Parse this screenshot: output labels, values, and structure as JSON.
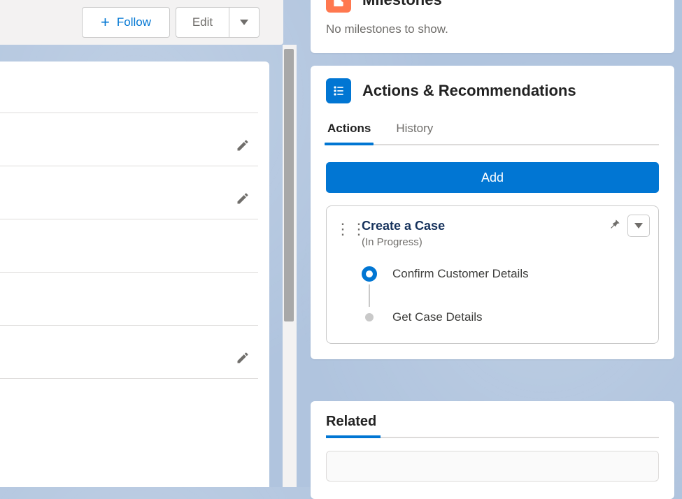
{
  "leftHeader": {
    "followLabel": "Follow",
    "editLabel": "Edit"
  },
  "milestones": {
    "title": "Milestones",
    "emptyText": "No milestones to show."
  },
  "actionsRec": {
    "title": "Actions & Recommendations",
    "tabs": {
      "actions": "Actions",
      "history": "History"
    },
    "addLabel": "Add",
    "flow": {
      "title": "Create a Case",
      "status": "(In Progress)",
      "steps": {
        "current": "Confirm Customer Details",
        "next": "Get Case Details"
      }
    }
  },
  "related": {
    "title": "Related"
  }
}
